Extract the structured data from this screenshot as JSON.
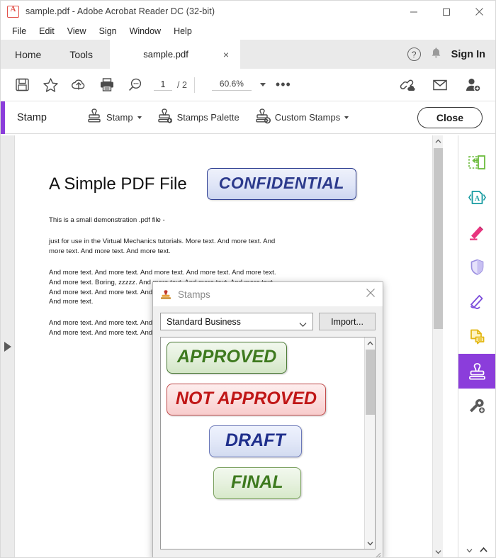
{
  "window": {
    "title": "sample.pdf - Adobe Acrobat Reader DC (32-bit)",
    "app_icon": "pdf-file-icon",
    "minimize_label": "–",
    "maximize_label": "□",
    "close_label": "×"
  },
  "menubar": {
    "items": [
      {
        "label": "File"
      },
      {
        "label": "Edit"
      },
      {
        "label": "View"
      },
      {
        "label": "Sign"
      },
      {
        "label": "Window"
      },
      {
        "label": "Help"
      }
    ]
  },
  "tabbar": {
    "home_label": "Home",
    "tools_label": "Tools",
    "document_tab": "sample.pdf",
    "tab_close": "×",
    "help_icon": "question-mark-icon",
    "help_glyph": "?",
    "bell_icon": "notification-bell-icon",
    "signin_label": "Sign In"
  },
  "toolbar": {
    "save_icon": "save-disk-icon",
    "bookmark_icon": "star-icon",
    "upload_icon": "upload-cloud-icon",
    "print_icon": "printer-icon",
    "find_icon": "search-magnifier-icon",
    "page_current": "1",
    "page_total": "/ 2",
    "zoom_level": "60.6%",
    "zoom_caret_icon": "chevron-down-icon",
    "more_tools_label": "•••",
    "share_link_icon": "link-cloud-icon",
    "email_icon": "envelope-icon",
    "add_person_icon": "person-add-icon"
  },
  "ribbon": {
    "title": "Stamp",
    "items": [
      {
        "label": "Stamp",
        "icon": "stamp-icon",
        "has_caret": true
      },
      {
        "label": "Stamps Palette",
        "icon": "stamps-palette-icon",
        "has_caret": false
      },
      {
        "label": "Custom Stamps",
        "icon": "custom-stamp-icon",
        "has_caret": true
      }
    ],
    "close_label": "Close",
    "accent_color": "#8b3ddb"
  },
  "document": {
    "title": "A Simple PDF File",
    "stamp_overlay": "CONFIDENTIAL",
    "stamp_color": "#2c3a8c",
    "paragraphs": [
      "This is a small demonstration .pdf file -",
      "just for use in the Virtual Mechanics tutorials. More text. And more text. And more text. And more text. And more text.",
      "And more text. And more text. And more text. And more text. And more text. And more text. Boring, zzzzz. And more text. And more text. And more text. And more text. And more text. And more text. And more text. And more text. And more text.",
      "And more text. And more text. And more text. And more text. And more text. And more text. And more text. And more text."
    ]
  },
  "left_rail": {
    "expand_icon": "expand-panel-arrow-icon"
  },
  "right_sidebar": {
    "tools": [
      {
        "name": "export-pdf-icon",
        "color": "#6cbb3c"
      },
      {
        "name": "compress-pdf-icon",
        "color": "#149aa0"
      },
      {
        "name": "edit-highlight-icon",
        "color": "#e8357f"
      },
      {
        "name": "protect-shield-icon",
        "color": "#9b8fe0"
      },
      {
        "name": "fill-and-sign-icon",
        "color": "#7c4ddb"
      },
      {
        "name": "comment-icon",
        "color": "#e3b712"
      },
      {
        "name": "stamp-tool-icon",
        "color": "#ffffff",
        "active": true
      },
      {
        "name": "more-tools-wrench-icon",
        "color": "#5a5a5a"
      }
    ],
    "scroll_down_icon": "chevron-down-icon",
    "scroll_up_icon": "chevron-up-icon"
  },
  "dialog": {
    "title": "Stamps",
    "icon": "stamp-dialog-icon",
    "close_icon": "close-icon",
    "category_value": "Standard Business",
    "category_caret": "chevron-down-icon",
    "import_label": "Import...",
    "stamps": [
      {
        "label": "APPROVED",
        "style": "approved",
        "color": "#3e7a1f"
      },
      {
        "label": "NOT APPROVED",
        "style": "notapproved",
        "color": "#c01717"
      },
      {
        "label": "DRAFT",
        "style": "draft",
        "color": "#1f2f8c"
      },
      {
        "label": "FINAL",
        "style": "final",
        "color": "#3e7a1f"
      }
    ]
  }
}
